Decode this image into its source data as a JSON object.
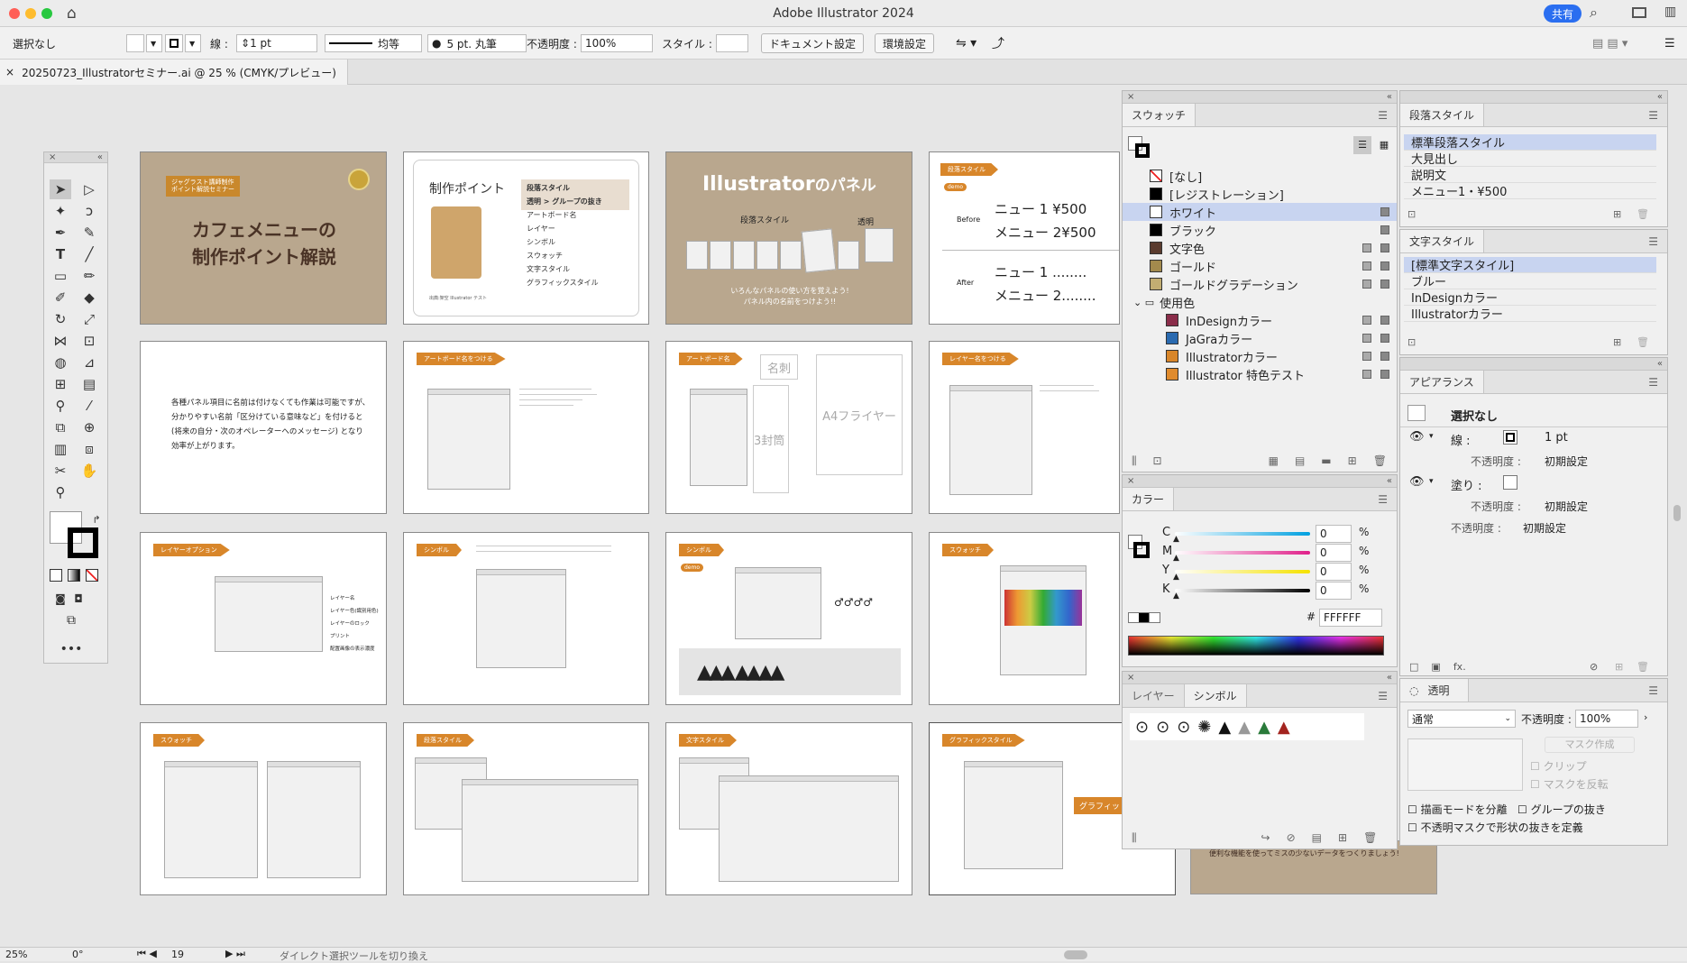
{
  "window": {
    "title": "Adobe Illustrator 2024",
    "share_label": "共有"
  },
  "controlbar": {
    "selection": "選択なし",
    "stroke_label": "線 :",
    "stroke_weight": "1 pt",
    "stroke_profile": "均等",
    "brush": "5 pt. 丸筆",
    "opacity_label": "不透明度 :",
    "opacity_value": "100%",
    "style_label": "スタイル :",
    "doc_setup_button": "ドキュメント設定",
    "prefs_button": "環境設定"
  },
  "document": {
    "tab_title": "20250723_Illustratorセミナー.ai @ 25 % (CMYK/プレビュー)"
  },
  "artboards": {
    "a1": {
      "badge": "ジャグラスト講師制作\nポイント解説セミナー",
      "title1": "カフェメニューの",
      "title2": "制作ポイント解説"
    },
    "a2": {
      "heading": "制作ポイント",
      "items": [
        "段落スタイル",
        "透明 > グループの抜き",
        "アートボード名",
        "レイヤー",
        "シンボル",
        "スウォッチ",
        "文字スタイル",
        "グラフィックスタイル"
      ],
      "caption": "出典:架空 Illustrator テスト"
    },
    "a3": {
      "title_a": "Illustrator",
      "title_b": "のパネル",
      "label_a": "段落スタイル",
      "label_b": "透明",
      "sub1": "いろんなパネルの使い方を覚えよう!",
      "sub2": "パネル内の名前をつけよう!!"
    },
    "a4": {
      "label": "段落スタイル",
      "demo": "demo",
      "before": "Before",
      "after": "After",
      "b1": "ニュー 1 ¥500",
      "b2": "メニュー 2¥500",
      "a1": "ニュー 1 ........",
      "a2": "メニュー 2........"
    },
    "a5": {
      "lines": [
        "各種パネル項目に名前は付けなくても作業は可能ですが、",
        "分かりやすい名前「区分けている意味など」を付けると",
        "(将来の自分・次のオペレーターへのメッセージ) となり",
        "効率が上がります。"
      ]
    },
    "a6": {
      "label": "アートボード名をつける"
    },
    "a7": {
      "label": "アートボード名",
      "meishi": "名刺",
      "flyer": "A4フライヤー",
      "envelope": "3封筒"
    },
    "a8": {
      "label": "レイヤー名をつける"
    },
    "a9": {
      "label": "レイヤーオプション",
      "r1": "レイヤー名",
      "r2": "レイヤー色(識別用色)",
      "r3": "レイヤーのロック",
      "r4": "プリント",
      "r5": "配置画像の表示濃度"
    },
    "a10": {
      "label": "シンボル"
    },
    "a11": {
      "label": "シンボル",
      "demo": "demo"
    },
    "a12": {
      "label": "スウォッチ"
    },
    "a13": {
      "label": "スウォッチ"
    },
    "a14": {
      "label": "段落スタイル"
    },
    "a15": {
      "label": "文字スタイル"
    },
    "a16": {
      "label": "グラフィックスタイル",
      "side": "グラフィッ"
    },
    "a17": {
      "text": "便利な機能を使ってミスの少ないデータをつくりましょう!"
    }
  },
  "swatches": {
    "tab": "スウォッチ",
    "items": [
      {
        "name": "[なし]",
        "color": "#ffffff",
        "none": true
      },
      {
        "name": "[レジストレーション]",
        "color": "#000000"
      },
      {
        "name": "ホワイト",
        "color": "#ffffff",
        "selected": true
      },
      {
        "name": "ブラック",
        "color": "#000000"
      },
      {
        "name": "文字色",
        "color": "#5a3b2e"
      },
      {
        "name": "ゴールド",
        "color": "#a38a4d"
      },
      {
        "name": "ゴールドグラデーション",
        "color": "#c2ad72"
      },
      {
        "name": "使用色",
        "color": "",
        "folder": true
      },
      {
        "name": "InDesignカラー",
        "color": "#8a2d4a",
        "indent": true
      },
      {
        "name": "JaGraカラー",
        "color": "#2a6ab0",
        "indent": true
      },
      {
        "name": "Illustratorカラー",
        "color": "#d8862a",
        "indent": true
      },
      {
        "name": "Illustrator 特色テスト",
        "color": "#e08b2d",
        "indent": true
      }
    ]
  },
  "para_styles": {
    "tab": "段落スタイル",
    "items": [
      "標準段落スタイル",
      "大見出し",
      "説明文",
      "メニュー1・¥500"
    ]
  },
  "char_styles": {
    "tab": "文字スタイル",
    "items": [
      "[標準文字スタイル]",
      "ブルー",
      "InDesignカラー",
      "Illustratorカラー"
    ]
  },
  "color_panel": {
    "tab": "カラー",
    "channels": [
      {
        "name": "C",
        "value": "0",
        "unit": "%"
      },
      {
        "name": "M",
        "value": "0",
        "unit": "%"
      },
      {
        "name": "Y",
        "value": "0",
        "unit": "%"
      },
      {
        "name": "K",
        "value": "0",
        "unit": "%"
      }
    ],
    "hash": "#",
    "hex": "FFFFFF"
  },
  "appearance": {
    "tab": "アピアランス",
    "title": "選択なし",
    "stroke_label": "線 :",
    "stroke_value": "1 pt",
    "opacity_label": "不透明度 :",
    "opacity_value": "初期設定",
    "fill_label": "塗り :",
    "fill_opacity_label": "不透明度 :",
    "fill_opacity_value": "初期設定",
    "obj_opacity_label": "不透明度 :",
    "obj_opacity_value": "初期設定",
    "fx": "fx."
  },
  "layers_panel": {
    "tab_layers": "レイヤー",
    "tab_symbols": "シンボル"
  },
  "transparency": {
    "tab": "透明",
    "mode": "通常",
    "opacity_label": "不透明度 :",
    "opacity_value": "100%",
    "make_mask": "マスク作成",
    "clip": "クリップ",
    "invert": "マスクを反転",
    "isolate": "描画モードを分離",
    "knockout": "グループの抜き",
    "opacity_mask": "不透明マスクで形状の抜きを定義"
  },
  "statusbar": {
    "zoom": "25%",
    "angle": "0°",
    "artboard_no": "19",
    "tool_hint": "ダイレクト選択ツールを切り換え"
  }
}
